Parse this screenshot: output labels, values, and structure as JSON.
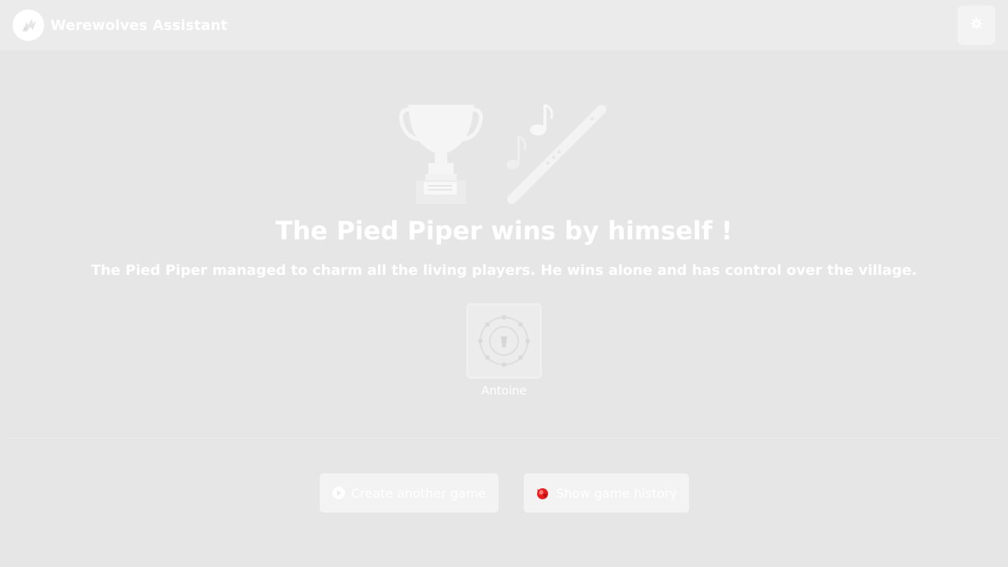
{
  "header": {
    "app_title": "Werewolves Assistant",
    "logo_icon": "werewolf-logo-icon",
    "settings_icon": "gear-icon"
  },
  "result": {
    "title": "The Pied Piper wins by himself !",
    "description": "The Pied Piper managed to charm all the living players. He wins alone and has control over the village."
  },
  "winners": [
    {
      "name": "Antoine",
      "role_icon": "pied-piper-role-icon"
    }
  ],
  "actions": {
    "create_game": "Create another game",
    "show_history": "Show game history"
  },
  "colors": {
    "background": "#e6e6e6",
    "navbar": "#ebebeb",
    "history_icon_accent": "#e61e1e"
  }
}
